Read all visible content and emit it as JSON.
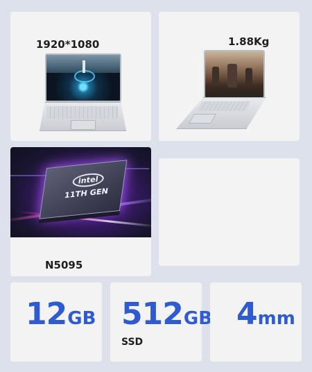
{
  "cards": {
    "resolution": {
      "label": "1920*1080"
    },
    "weight": {
      "label": "1.88Kg"
    },
    "cpu": {
      "label": "N5095",
      "chip_brand": "intel",
      "chip_gen": "11TH GEN"
    },
    "ram": {
      "value": "12",
      "unit": "GB"
    },
    "ssd": {
      "value": "512",
      "unit": "GB",
      "caption": "SSD"
    },
    "thickness": {
      "value": "4",
      "unit": "mm"
    }
  },
  "colors": {
    "page_bg": "#dde1ec",
    "card_bg": "#f3f3f4",
    "accent_blue": "#2f5bd0",
    "label_text": "#1e1e1e"
  }
}
